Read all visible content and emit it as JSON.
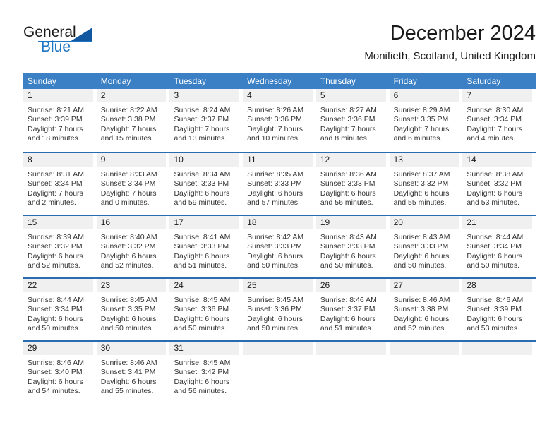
{
  "brand": {
    "name_part1": "General",
    "name_part2": "Blue",
    "logo_icon": "triangle-logo-icon"
  },
  "header": {
    "month_title": "December 2024",
    "location": "Monifieth, Scotland, United Kingdom"
  },
  "colors": {
    "header_blue": "#3b7fc4",
    "divider_blue": "#2b6cb0",
    "day_band_gray": "#f0f0f0",
    "brand_blue": "#1f76c4",
    "logo_blue": "#1258a0"
  },
  "day_headers": [
    "Sunday",
    "Monday",
    "Tuesday",
    "Wednesday",
    "Thursday",
    "Friday",
    "Saturday"
  ],
  "weeks": [
    [
      {
        "day": "1",
        "sunrise": "Sunrise: 8:21 AM",
        "sunset": "Sunset: 3:39 PM",
        "daylight_line1": "Daylight: 7 hours",
        "daylight_line2": "and 18 minutes."
      },
      {
        "day": "2",
        "sunrise": "Sunrise: 8:22 AM",
        "sunset": "Sunset: 3:38 PM",
        "daylight_line1": "Daylight: 7 hours",
        "daylight_line2": "and 15 minutes."
      },
      {
        "day": "3",
        "sunrise": "Sunrise: 8:24 AM",
        "sunset": "Sunset: 3:37 PM",
        "daylight_line1": "Daylight: 7 hours",
        "daylight_line2": "and 13 minutes."
      },
      {
        "day": "4",
        "sunrise": "Sunrise: 8:26 AM",
        "sunset": "Sunset: 3:36 PM",
        "daylight_line1": "Daylight: 7 hours",
        "daylight_line2": "and 10 minutes."
      },
      {
        "day": "5",
        "sunrise": "Sunrise: 8:27 AM",
        "sunset": "Sunset: 3:36 PM",
        "daylight_line1": "Daylight: 7 hours",
        "daylight_line2": "and 8 minutes."
      },
      {
        "day": "6",
        "sunrise": "Sunrise: 8:29 AM",
        "sunset": "Sunset: 3:35 PM",
        "daylight_line1": "Daylight: 7 hours",
        "daylight_line2": "and 6 minutes."
      },
      {
        "day": "7",
        "sunrise": "Sunrise: 8:30 AM",
        "sunset": "Sunset: 3:34 PM",
        "daylight_line1": "Daylight: 7 hours",
        "daylight_line2": "and 4 minutes."
      }
    ],
    [
      {
        "day": "8",
        "sunrise": "Sunrise: 8:31 AM",
        "sunset": "Sunset: 3:34 PM",
        "daylight_line1": "Daylight: 7 hours",
        "daylight_line2": "and 2 minutes."
      },
      {
        "day": "9",
        "sunrise": "Sunrise: 8:33 AM",
        "sunset": "Sunset: 3:34 PM",
        "daylight_line1": "Daylight: 7 hours",
        "daylight_line2": "and 0 minutes."
      },
      {
        "day": "10",
        "sunrise": "Sunrise: 8:34 AM",
        "sunset": "Sunset: 3:33 PM",
        "daylight_line1": "Daylight: 6 hours",
        "daylight_line2": "and 59 minutes."
      },
      {
        "day": "11",
        "sunrise": "Sunrise: 8:35 AM",
        "sunset": "Sunset: 3:33 PM",
        "daylight_line1": "Daylight: 6 hours",
        "daylight_line2": "and 57 minutes."
      },
      {
        "day": "12",
        "sunrise": "Sunrise: 8:36 AM",
        "sunset": "Sunset: 3:33 PM",
        "daylight_line1": "Daylight: 6 hours",
        "daylight_line2": "and 56 minutes."
      },
      {
        "day": "13",
        "sunrise": "Sunrise: 8:37 AM",
        "sunset": "Sunset: 3:32 PM",
        "daylight_line1": "Daylight: 6 hours",
        "daylight_line2": "and 55 minutes."
      },
      {
        "day": "14",
        "sunrise": "Sunrise: 8:38 AM",
        "sunset": "Sunset: 3:32 PM",
        "daylight_line1": "Daylight: 6 hours",
        "daylight_line2": "and 53 minutes."
      }
    ],
    [
      {
        "day": "15",
        "sunrise": "Sunrise: 8:39 AM",
        "sunset": "Sunset: 3:32 PM",
        "daylight_line1": "Daylight: 6 hours",
        "daylight_line2": "and 52 minutes."
      },
      {
        "day": "16",
        "sunrise": "Sunrise: 8:40 AM",
        "sunset": "Sunset: 3:32 PM",
        "daylight_line1": "Daylight: 6 hours",
        "daylight_line2": "and 52 minutes."
      },
      {
        "day": "17",
        "sunrise": "Sunrise: 8:41 AM",
        "sunset": "Sunset: 3:33 PM",
        "daylight_line1": "Daylight: 6 hours",
        "daylight_line2": "and 51 minutes."
      },
      {
        "day": "18",
        "sunrise": "Sunrise: 8:42 AM",
        "sunset": "Sunset: 3:33 PM",
        "daylight_line1": "Daylight: 6 hours",
        "daylight_line2": "and 50 minutes."
      },
      {
        "day": "19",
        "sunrise": "Sunrise: 8:43 AM",
        "sunset": "Sunset: 3:33 PM",
        "daylight_line1": "Daylight: 6 hours",
        "daylight_line2": "and 50 minutes."
      },
      {
        "day": "20",
        "sunrise": "Sunrise: 8:43 AM",
        "sunset": "Sunset: 3:33 PM",
        "daylight_line1": "Daylight: 6 hours",
        "daylight_line2": "and 50 minutes."
      },
      {
        "day": "21",
        "sunrise": "Sunrise: 8:44 AM",
        "sunset": "Sunset: 3:34 PM",
        "daylight_line1": "Daylight: 6 hours",
        "daylight_line2": "and 50 minutes."
      }
    ],
    [
      {
        "day": "22",
        "sunrise": "Sunrise: 8:44 AM",
        "sunset": "Sunset: 3:34 PM",
        "daylight_line1": "Daylight: 6 hours",
        "daylight_line2": "and 50 minutes."
      },
      {
        "day": "23",
        "sunrise": "Sunrise: 8:45 AM",
        "sunset": "Sunset: 3:35 PM",
        "daylight_line1": "Daylight: 6 hours",
        "daylight_line2": "and 50 minutes."
      },
      {
        "day": "24",
        "sunrise": "Sunrise: 8:45 AM",
        "sunset": "Sunset: 3:36 PM",
        "daylight_line1": "Daylight: 6 hours",
        "daylight_line2": "and 50 minutes."
      },
      {
        "day": "25",
        "sunrise": "Sunrise: 8:45 AM",
        "sunset": "Sunset: 3:36 PM",
        "daylight_line1": "Daylight: 6 hours",
        "daylight_line2": "and 50 minutes."
      },
      {
        "day": "26",
        "sunrise": "Sunrise: 8:46 AM",
        "sunset": "Sunset: 3:37 PM",
        "daylight_line1": "Daylight: 6 hours",
        "daylight_line2": "and 51 minutes."
      },
      {
        "day": "27",
        "sunrise": "Sunrise: 8:46 AM",
        "sunset": "Sunset: 3:38 PM",
        "daylight_line1": "Daylight: 6 hours",
        "daylight_line2": "and 52 minutes."
      },
      {
        "day": "28",
        "sunrise": "Sunrise: 8:46 AM",
        "sunset": "Sunset: 3:39 PM",
        "daylight_line1": "Daylight: 6 hours",
        "daylight_line2": "and 53 minutes."
      }
    ],
    [
      {
        "day": "29",
        "sunrise": "Sunrise: 8:46 AM",
        "sunset": "Sunset: 3:40 PM",
        "daylight_line1": "Daylight: 6 hours",
        "daylight_line2": "and 54 minutes."
      },
      {
        "day": "30",
        "sunrise": "Sunrise: 8:46 AM",
        "sunset": "Sunset: 3:41 PM",
        "daylight_line1": "Daylight: 6 hours",
        "daylight_line2": "and 55 minutes."
      },
      {
        "day": "31",
        "sunrise": "Sunrise: 8:45 AM",
        "sunset": "Sunset: 3:42 PM",
        "daylight_line1": "Daylight: 6 hours",
        "daylight_line2": "and 56 minutes."
      },
      {
        "day": "",
        "sunrise": "",
        "sunset": "",
        "daylight_line1": "",
        "daylight_line2": ""
      },
      {
        "day": "",
        "sunrise": "",
        "sunset": "",
        "daylight_line1": "",
        "daylight_line2": ""
      },
      {
        "day": "",
        "sunrise": "",
        "sunset": "",
        "daylight_line1": "",
        "daylight_line2": ""
      },
      {
        "day": "",
        "sunrise": "",
        "sunset": "",
        "daylight_line1": "",
        "daylight_line2": ""
      }
    ]
  ]
}
